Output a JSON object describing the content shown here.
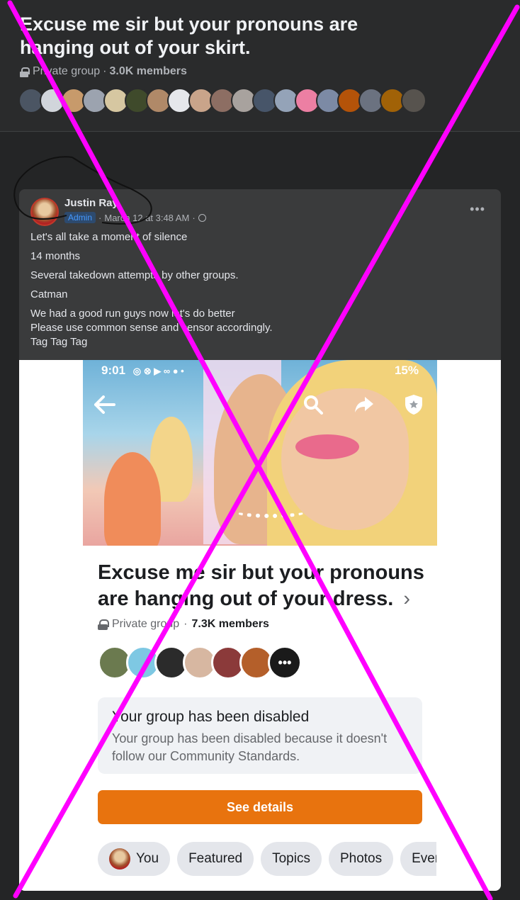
{
  "group": {
    "title": "Excuse me sir but your pronouns are hanging out of your skirt.",
    "privacy": "Private group",
    "separator": "·",
    "members": "3.0K members",
    "avatar_colors": [
      "#4b5563",
      "#d1d5db",
      "#c79a6b",
      "#9ca3af",
      "#d6c7a1",
      "#3f4a2b",
      "#b08968",
      "#e5e7eb",
      "#c9a48a",
      "#8d6e63",
      "#a8a29e",
      "#475569",
      "#94a3b8",
      "#ec7fa3",
      "#7c8aa5",
      "#b45309",
      "#6b7280",
      "#a16207",
      "#57534e"
    ]
  },
  "post": {
    "author": "Justin Ray",
    "role_badge": "Admin",
    "timestamp": "March 12 at 3:48 AM",
    "separator": "·",
    "more_icon": "more-horizontal-icon",
    "lines": [
      "Let's all take a moment of silence",
      "14 months",
      "Several takedown attempts by other groups.",
      "Catman",
      "We had a good run guys now let's do better",
      "Please use common sense and censor accordingly.",
      "Tag Tag Tag"
    ]
  },
  "screenshot": {
    "status_time": "9:01",
    "status_left_icons": "◎ ⊗ ▶ ∞ ● •",
    "status_right": "15%",
    "title": "Excuse me sir but your pronouns are hanging out of your dress.",
    "chevron": "›",
    "privacy": "Private group",
    "separator": "·",
    "members": "7.3K members",
    "member_avatar_colors": [
      "#6b7a4f",
      "#7ec8e3",
      "#2b2b2b",
      "#d7b7a1",
      "#8b3a3a",
      "#b45f2a",
      "#1a1a1a"
    ],
    "more_members": "•••",
    "disabled_title": "Your group has been disabled",
    "disabled_text": "Your group has been disabled because it doesn't follow our Community Standards.",
    "see_details": "See details",
    "tabs": [
      "You",
      "Featured",
      "Topics",
      "Photos",
      "Events"
    ]
  },
  "colors": {
    "overlay_x": "#ff00ff",
    "accent_orange": "#e8730e",
    "admin_blue": "#4599ff"
  }
}
